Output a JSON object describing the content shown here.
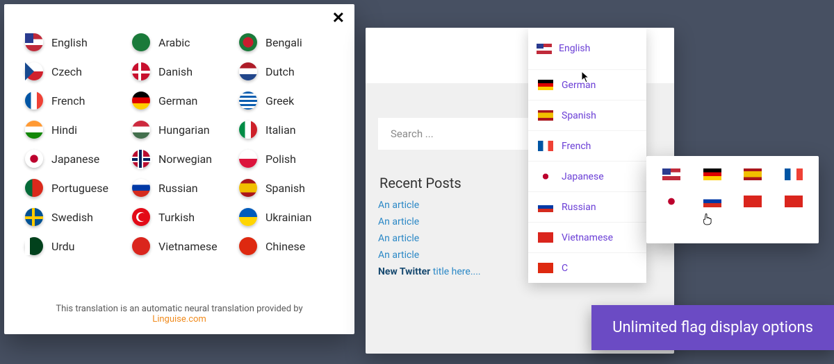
{
  "modal": {
    "languages": [
      {
        "label": "English",
        "flag": "f-us"
      },
      {
        "label": "Arabic",
        "flag": "f-ar"
      },
      {
        "label": "Bengali",
        "flag": "f-be"
      },
      {
        "label": "Czech",
        "flag": "f-cz"
      },
      {
        "label": "Danish",
        "flag": "f-dk"
      },
      {
        "label": "Dutch",
        "flag": "f-nl"
      },
      {
        "label": "French",
        "flag": "f-fr"
      },
      {
        "label": "German",
        "flag": "f-de"
      },
      {
        "label": "Greek",
        "flag": "f-gr"
      },
      {
        "label": "Hindi",
        "flag": "f-in"
      },
      {
        "label": "Hungarian",
        "flag": "f-hu"
      },
      {
        "label": "Italian",
        "flag": "f-it"
      },
      {
        "label": "Japanese",
        "flag": "f-jp"
      },
      {
        "label": "Norwegian",
        "flag": "f-no"
      },
      {
        "label": "Polish",
        "flag": "f-pl"
      },
      {
        "label": "Portuguese",
        "flag": "f-pt"
      },
      {
        "label": "Russian",
        "flag": "f-ru"
      },
      {
        "label": "Spanish",
        "flag": "f-es"
      },
      {
        "label": "Swedish",
        "flag": "f-sv"
      },
      {
        "label": "Turkish",
        "flag": "f-tr"
      },
      {
        "label": "Ukrainian",
        "flag": "f-ua"
      },
      {
        "label": "Urdu",
        "flag": "f-ur"
      },
      {
        "label": "Vietnamese",
        "flag": "f-vn"
      },
      {
        "label": "Chinese",
        "flag": "f-cn"
      }
    ],
    "footer_text": "This translation is an automatic neural translation provided by",
    "footer_link": "Linguise.com"
  },
  "site": {
    "header_language": {
      "label": "English",
      "flag": "f-us"
    },
    "search_placeholder": "Search ...",
    "recent_title": "Recent Posts",
    "posts": [
      {
        "text": "An article",
        "bold": false
      },
      {
        "text": "An article",
        "bold": false
      },
      {
        "text": "An article",
        "bold": false
      },
      {
        "text": "An article",
        "bold": false
      }
    ],
    "last_post_prefix": "New Twitter",
    "last_post_rest": " title here....",
    "dropdown": [
      {
        "label": "German",
        "flag": "f-de"
      },
      {
        "label": "Spanish",
        "flag": "f-es"
      },
      {
        "label": "French",
        "flag": "f-fr"
      },
      {
        "label": "Japanese",
        "flag": "f-jp"
      },
      {
        "label": "Russian",
        "flag": "f-ru"
      },
      {
        "label": "Vietnamese",
        "flag": "f-vn"
      },
      {
        "label": "C",
        "flag": "f-cn"
      }
    ]
  },
  "flag_grid": [
    "f-us",
    "f-de",
    "f-es",
    "f-fr",
    "f-jp",
    "f-ru",
    "f-vn",
    "f-vn"
  ],
  "banner_text": "Unlimited flag display options"
}
